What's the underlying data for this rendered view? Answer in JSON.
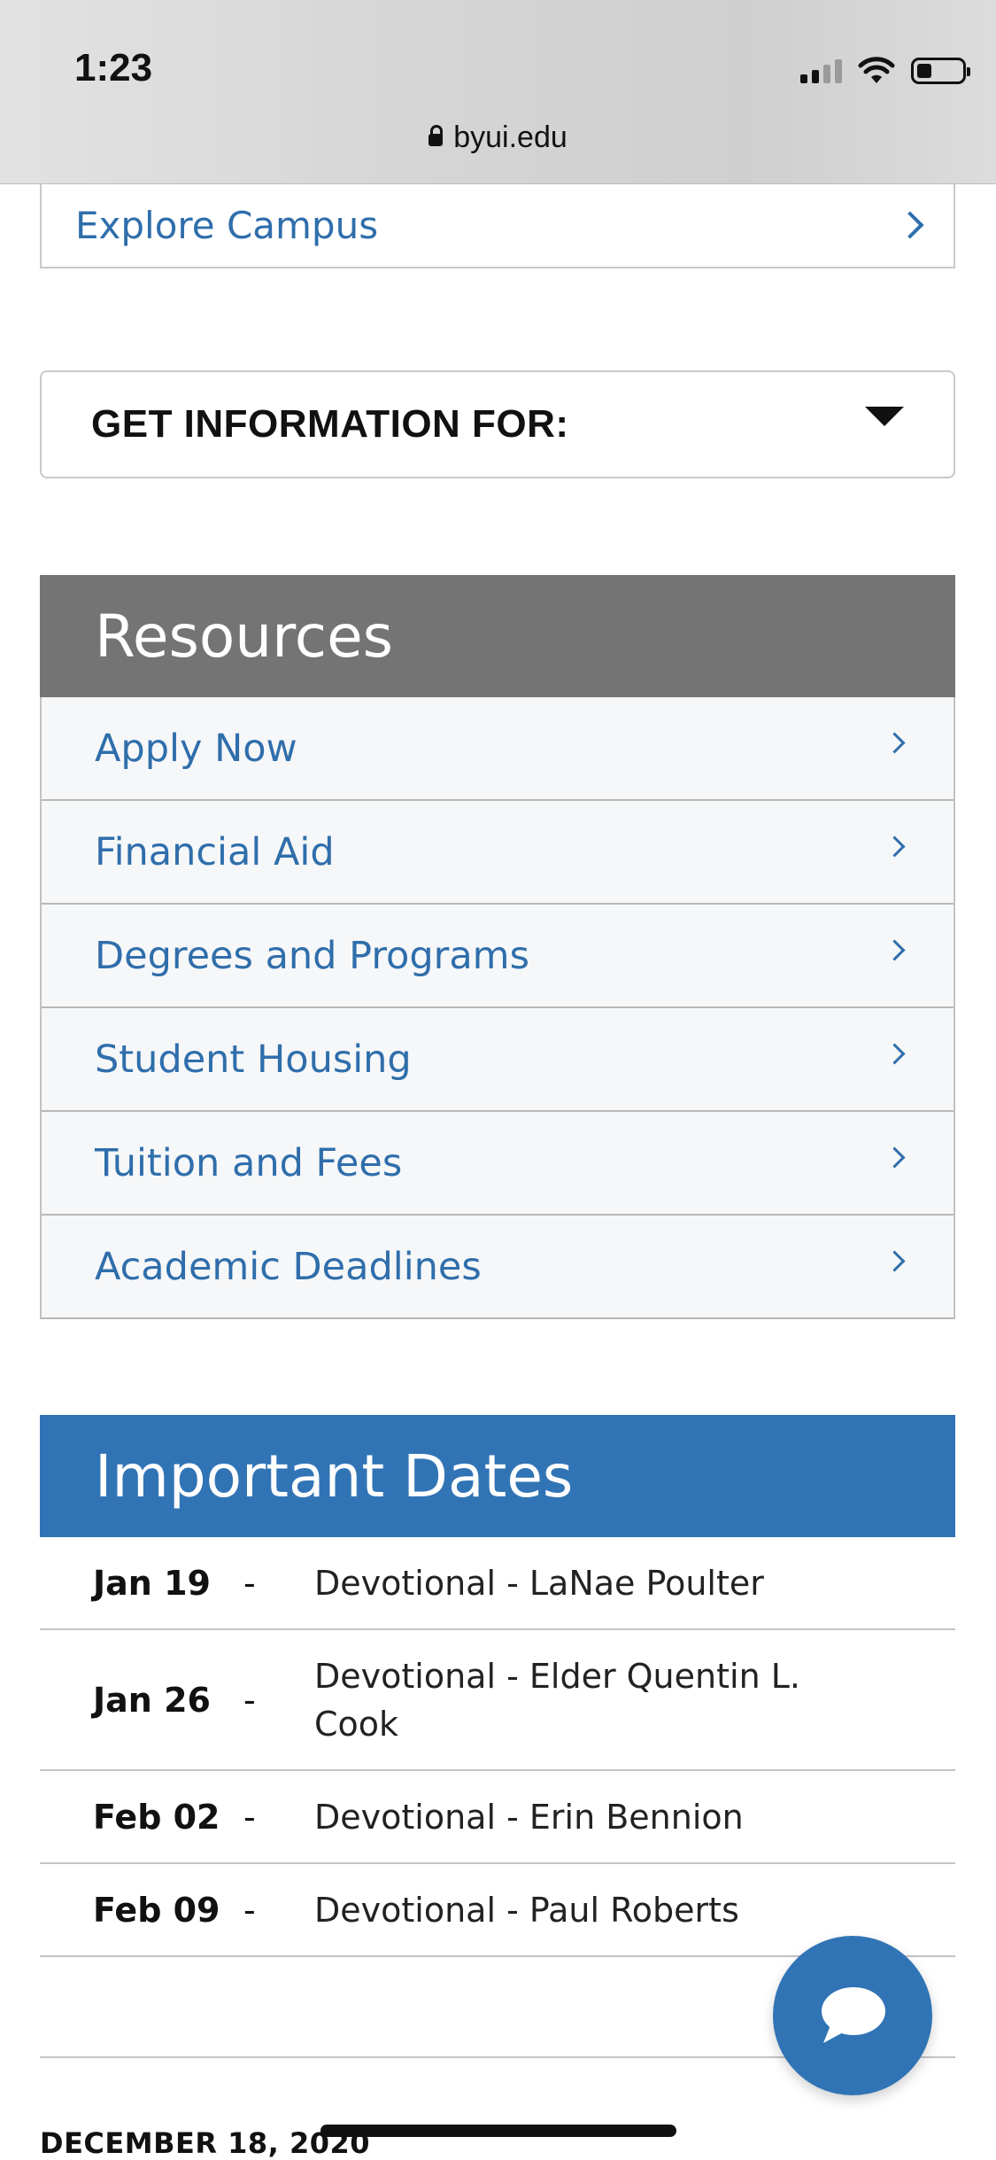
{
  "status_bar": {
    "time": "1:23",
    "url": "byui.edu"
  },
  "explore_link": {
    "label": "Explore Campus"
  },
  "info_select": {
    "label": "GET INFORMATION FOR:"
  },
  "resources": {
    "title": "Resources",
    "items": [
      {
        "label": "Apply Now"
      },
      {
        "label": "Financial Aid"
      },
      {
        "label": "Degrees and Programs"
      },
      {
        "label": "Student Housing"
      },
      {
        "label": "Tuition and Fees"
      },
      {
        "label": "Academic Deadlines"
      }
    ]
  },
  "important_dates": {
    "title": "Important Dates",
    "separator": "-",
    "events": [
      {
        "date": "Jan 19",
        "event": "Devotional - LaNae Poulter"
      },
      {
        "date": "Jan 26",
        "event": "Devotional - Elder Quentin L. Cook"
      },
      {
        "date": "Feb 02",
        "event": "Devotional - Erin Bennion"
      },
      {
        "date": "Feb 09",
        "event": "Devotional - Paul Roberts"
      }
    ]
  },
  "footer": {
    "date": "DECEMBER 18, 2020"
  },
  "colors": {
    "link_blue": "#2f6eab",
    "dates_header": "#3174b5",
    "resources_header": "#747474"
  },
  "icons": [
    "lock-icon",
    "signal-icon",
    "wifi-icon",
    "battery-icon",
    "chevron-right-icon",
    "caret-down-icon",
    "chat-bubble-icon"
  ]
}
